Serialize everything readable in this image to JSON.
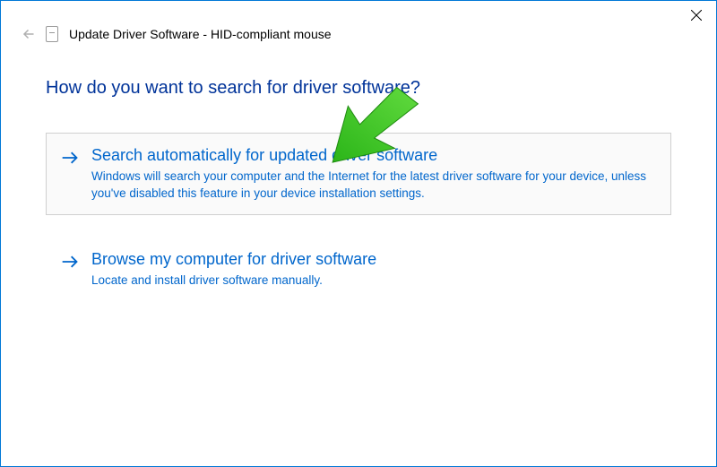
{
  "titlebar": {
    "close_label": "Close"
  },
  "header": {
    "back_label": "Back",
    "title": "Update Driver Software - HID-compliant mouse"
  },
  "main": {
    "question": "How do you want to search for driver software?"
  },
  "options": [
    {
      "title": "Search automatically for updated driver software",
      "desc": "Windows will search your computer and the Internet for the latest driver software for your device, unless you've disabled this feature in your device installation settings."
    },
    {
      "title": "Browse my computer for driver software",
      "desc": "Locate and install driver software manually."
    }
  ]
}
